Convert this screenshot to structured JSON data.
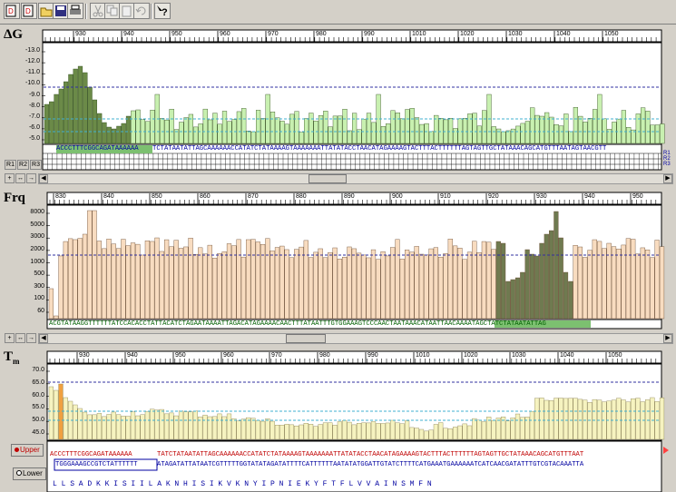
{
  "toolbar": {
    "icons": [
      "new-d-icon",
      "new-file-icon",
      "open-folder-icon",
      "save-icon",
      "print-icon",
      "cut-icon",
      "copy-icon",
      "paste-icon",
      "undo-icon",
      "help-icon"
    ]
  },
  "panels": {
    "dg": {
      "title": "ΔG",
      "ruler": [
        "930",
        "940",
        "950",
        "960",
        "970",
        "980",
        "990",
        "1010",
        "1020",
        "1030",
        "1040",
        "1050"
      ],
      "yticks": [
        "-13.0",
        "-12.0",
        "-11.0",
        "-10.0",
        "-9.0",
        "-8.0",
        "-7.0",
        "-6.0",
        "-5.0"
      ],
      "right_labels": [
        "R1",
        "R2",
        "R3"
      ],
      "r_buttons": [
        "R1",
        "R2",
        "R3"
      ],
      "sequence_rest": "TCTATAATATTAGCAAAAAACCATATCTATAAAAGTAAAAAAATTATATACCTAACATAGAAAAGTACTTTACTTTTTTAGTAGTTGCTATAAACAGCATGTTTAATAGTAACGTT"
    },
    "frq": {
      "title": "Frq",
      "ruler": [
        "830",
        "840",
        "850",
        "860",
        "870",
        "880",
        "890",
        "900",
        "910",
        "920",
        "930",
        "940",
        "950"
      ],
      "yticks": [
        "8000",
        "5000",
        "3000",
        "2000",
        "1000",
        "500",
        "300",
        "100",
        "60"
      ],
      "sequence": "ACGTATAAGGTTTTTTATCCACACCTATTACATCTAGAATAAAATTAGACATAGAAAACAACTTTATAATTTGTGGAAAGTCCCAACTAATAAACATAATTAACAAAATAGCTATCTATAATATTAG"
    },
    "tm": {
      "title": "T",
      "title_sub": "m",
      "ruler": [
        "930",
        "940",
        "950",
        "960",
        "970",
        "980",
        "990",
        "1010",
        "1020",
        "1030",
        "1040",
        "1050"
      ],
      "yticks": [
        "70.0",
        "65.0",
        "60.0",
        "55.0",
        "50.0",
        "45.0"
      ],
      "upper_label": "Upper",
      "lower_label": "Lower",
      "upper_seq_primer": "ACCCTTTCGGCAGATAAAAAA",
      "upper_seq_rest": "TATCTATAATATTAGCAAAAAACCATATCTATAAAAGTAAAAAAATTATATACCTAACATAGAAAAGTACTTTACTTTTTTAGTAGTTGCTATAAACAGCATGTTTAAT",
      "lower_seq_primer": "TGGGAAAGCCGTCTATTTTTT",
      "lower_seq_rest": "ATAGATATTATAATCGTTTTTGGTATATAGATATTTTCATTTTTTAATATATGGATTGTATCTTTTCATGAAATGAAAAAATCATCAACGATATTTGTCGTACAAATTA",
      "amino_acids": "L  L  S  A  D  K  K  I  S  I  I  L  A  K  N  H  I  S  I  K  V  K  N  Y  I  P  N  I  E  K  Y  F  T  F  L  V  V  A  I  N  S  M  F  N"
    }
  },
  "colors": {
    "bar_light_green": "#c8f0b0",
    "bar_dark_green": "#6b8a48",
    "bar_peach": "#f8dcc0",
    "bar_olive": "#6f7a50",
    "bar_yellow": "#f6f3c0",
    "bar_orange": "#f0a040",
    "seq_red": "#c00000",
    "seq_blue": "#0000a0",
    "highlight_green": "#7cc070"
  }
}
